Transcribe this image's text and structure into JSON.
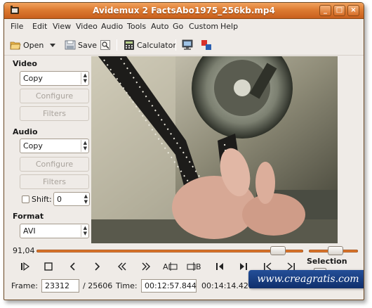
{
  "window": {
    "title": "Avidemux 2 FactsAbo1975_256kb.mp4",
    "buttons": {
      "minimize": "_",
      "maximize": "□",
      "close": "×"
    }
  },
  "menubar": [
    "File",
    "Edit",
    "View",
    "Video",
    "Audio",
    "Tools",
    "Auto",
    "Go",
    "Custom",
    "Help"
  ],
  "toolbar": {
    "open_label": "Open",
    "save_label": "Save",
    "calculator_label": "Calculator"
  },
  "video_panel": {
    "label": "Video",
    "codec": "Copy",
    "configure_label": "Configure",
    "filters_label": "Filters"
  },
  "audio_panel": {
    "label": "Audio",
    "codec": "Copy",
    "configure_label": "Configure",
    "filters_label": "Filters",
    "shift_label": "Shift:",
    "shift_value": "0"
  },
  "format_panel": {
    "label": "Format",
    "container": "AVI"
  },
  "timeline": {
    "position_label": "91,04",
    "position_fraction": 0.905
  },
  "selection_label": "Selection",
  "status": {
    "frame_label": "Frame:",
    "frame_value": "23312",
    "frame_total": "/ 25606",
    "time_label": "Time:",
    "time_value": "00:12:57.844",
    "time_total": "00:14:14.421"
  },
  "watermark": "www.creagratis.com",
  "colors": {
    "titlebar": "#dd7b32",
    "accent": "#e08a3c",
    "watermark_bg": "#1a3f85"
  },
  "icons": {
    "open": "folder-open-icon",
    "save": "floppy-icon",
    "properties": "properties-icon",
    "calculator": "calculator-icon",
    "preview": "monitor-icon",
    "output": "color-swap-icon"
  }
}
